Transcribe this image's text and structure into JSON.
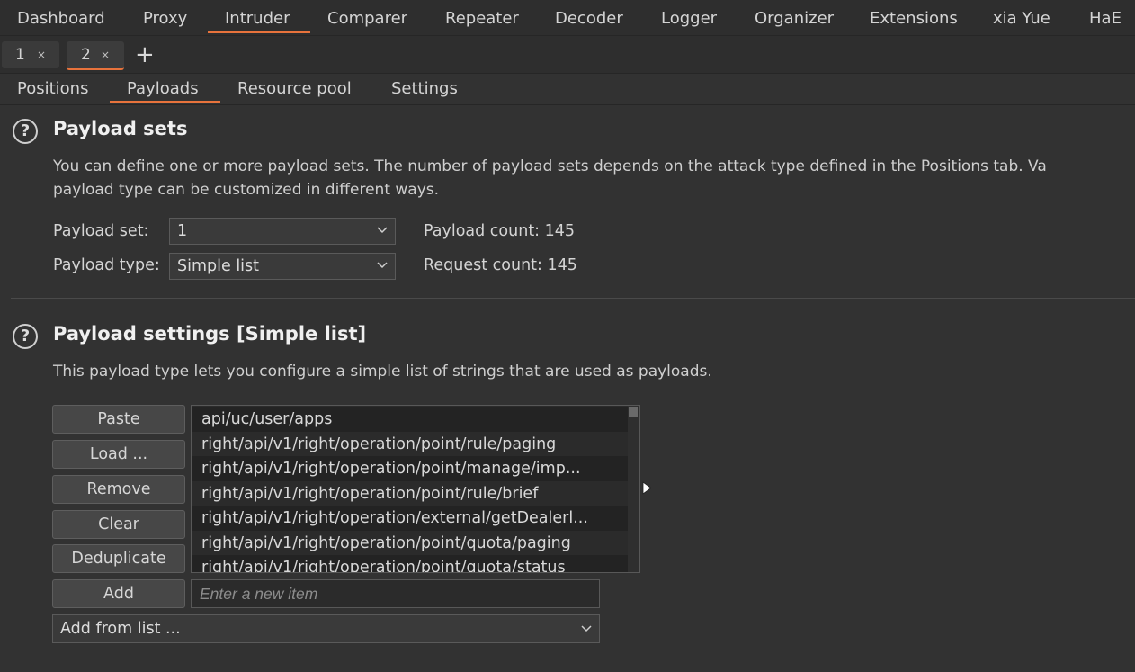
{
  "top_tabs": [
    {
      "label": "Dashboard"
    },
    {
      "label": "Proxy"
    },
    {
      "label": "Intruder"
    },
    {
      "label": "Comparer"
    },
    {
      "label": "Repeater"
    },
    {
      "label": "Decoder"
    },
    {
      "label": "Logger"
    },
    {
      "label": "Organizer"
    },
    {
      "label": "Extensions"
    },
    {
      "label": "xia Yue"
    },
    {
      "label": "HaE"
    }
  ],
  "instance_tabs": [
    {
      "label": "1",
      "close": "×"
    },
    {
      "label": "2",
      "close": "×"
    }
  ],
  "new_tab_label": "+",
  "sub_tabs": [
    {
      "label": "Positions"
    },
    {
      "label": "Payloads"
    },
    {
      "label": "Resource pool"
    },
    {
      "label": "Settings"
    }
  ],
  "payload_sets": {
    "help": "?",
    "title": "Payload sets",
    "description_line1": "You can define one or more payload sets. The number of payload sets depends on the attack type defined in the Positions tab. Va",
    "description_line2": "payload type can be customized in different ways.",
    "set_label": "Payload set:",
    "set_value": "1",
    "type_label": "Payload type:",
    "type_value": "Simple list",
    "payload_count": "Payload count: 145",
    "request_count": "Request count: 145"
  },
  "payload_settings": {
    "help": "?",
    "title": "Payload settings [Simple list]",
    "description": "This payload type lets you configure a simple list of strings that are used as payloads.",
    "buttons": {
      "paste": "Paste",
      "load": "Load ...",
      "remove": "Remove",
      "clear": "Clear",
      "deduplicate": "Deduplicate",
      "add": "Add"
    },
    "items": [
      "api/uc/user/apps",
      "right/api/v1/right/operation/point/rule/paging",
      "right/api/v1/right/operation/point/manage/imp...",
      "right/api/v1/right/operation/point/rule/brief",
      "right/api/v1/right/operation/external/getDealerl...",
      "right/api/v1/right/operation/point/quota/paging",
      "right/api/v1/right/operation/point/quota/status"
    ],
    "new_item_placeholder": "Enter a new item",
    "add_from_list": "Add from list ..."
  },
  "colors": {
    "accent": "#e8733c",
    "background": "#323232"
  }
}
